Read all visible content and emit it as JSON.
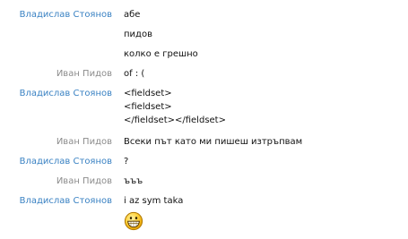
{
  "participants": {
    "vlad": "Владислав Стоянов",
    "ivan": "Иван Пидов"
  },
  "messages": [
    {
      "sender": "Владислав Стоянов",
      "lines": [
        "абе"
      ]
    },
    {
      "sender": "",
      "lines": [
        "пидов"
      ]
    },
    {
      "sender": "",
      "lines": [
        "колко е грешно"
      ]
    },
    {
      "sender": "Иван Пидов",
      "lines": [
        "of : ("
      ]
    },
    {
      "sender": "Владислав Стоянов",
      "lines": [
        "<fieldset>",
        "<fieldset>",
        "</fieldset></fieldset>"
      ]
    },
    {
      "sender": "Иван Пидов",
      "lines": [
        "Всеки път като ми пишеш изтръпвам"
      ]
    },
    {
      "sender": "Владислав Стоянов",
      "lines": [
        "?"
      ]
    },
    {
      "sender": "Иван Пидов",
      "lines": [
        "ъъъ"
      ]
    },
    {
      "sender": "Владислав Стоянов",
      "lines": [
        "i az sym taka"
      ],
      "emoji": "big-grin-emoticon"
    }
  ],
  "colors": {
    "vlad_name": "#3a82c3",
    "ivan_name": "#8c8c8c"
  }
}
